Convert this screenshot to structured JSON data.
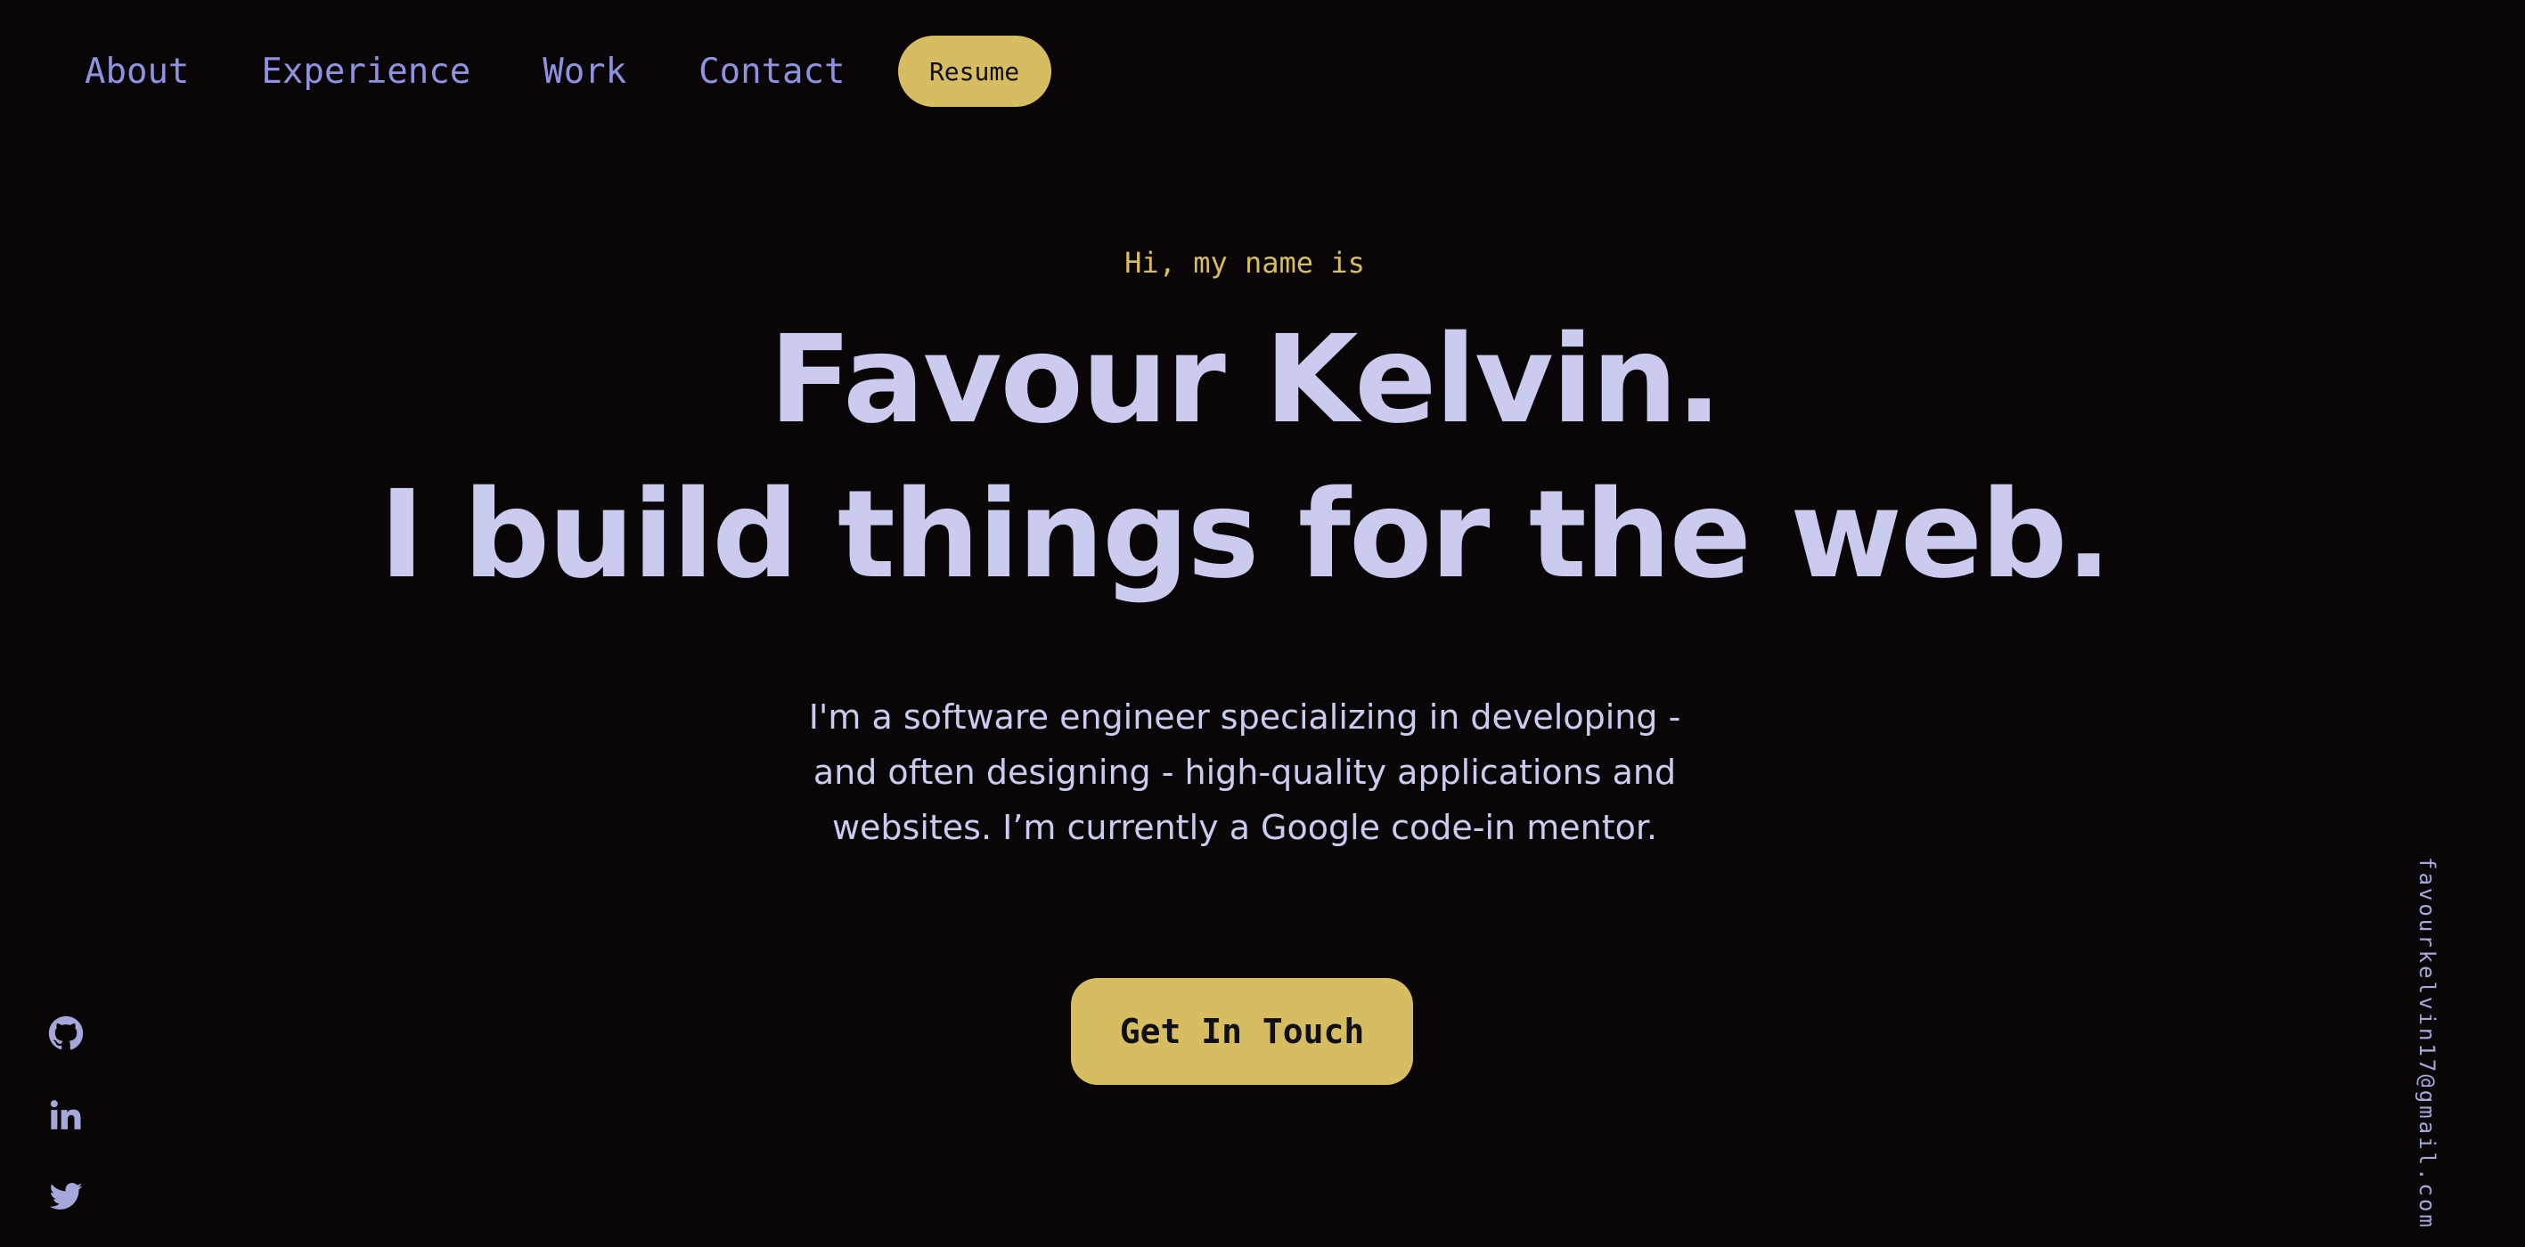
{
  "nav": {
    "links": [
      "About",
      "Experience",
      "Work",
      "Contact"
    ],
    "resume_label": "Resume"
  },
  "hero": {
    "greeting": "Hi, my name is",
    "name": "Favour Kelvin.",
    "tagline": "I build things for the web.",
    "description_lines": [
      "I'm a software engineer specializing in developing -",
      "and often designing - high-quality applications and",
      "websites. I’m currently a Google code-in mentor."
    ],
    "cta_label": "Get In Touch"
  },
  "social": {
    "icons": [
      "github-icon",
      "linkedin-icon",
      "twitter-icon"
    ]
  },
  "email": "favourkelvin17@gmail.com",
  "colors": {
    "background": "#0a0608",
    "accent": "#d6bd62",
    "nav_link": "#8f92e0",
    "text": "#cbcbf0"
  }
}
